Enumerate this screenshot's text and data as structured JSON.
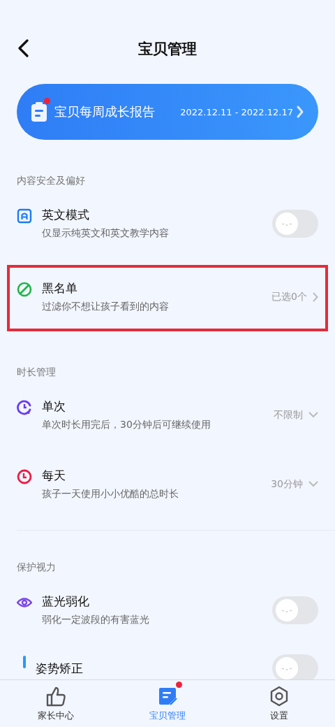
{
  "header": {
    "title": "宝贝管理"
  },
  "banner": {
    "title": "宝贝每周成长报告",
    "dates": "2022.12.11 - 2022.12.17",
    "unread": true
  },
  "sections": [
    {
      "title": "内容安全及偏好",
      "divider": false,
      "rows": [
        {
          "kind": "toggle",
          "title": "英文模式",
          "subtitle": "仅显示纯英文和英文教学内容",
          "on": false,
          "highlighted": false,
          "color": "#1e7cf0"
        },
        {
          "kind": "link",
          "title": "黑名单",
          "subtitle": "过滤你不想让孩子看到的内容",
          "value": "已选0个",
          "highlighted": true,
          "color": "#20b44a"
        }
      ]
    },
    {
      "title": "时长管理",
      "divider": true,
      "rows": [
        {
          "kind": "dropdown",
          "title": "单次",
          "subtitle": "单次时长用完后，30分钟后可继续使用",
          "value": "不限制",
          "highlighted": false,
          "color": "#6a3cf0"
        },
        {
          "kind": "dropdown",
          "title": "每天",
          "subtitle": "孩子一天使用小小优酷的总时长",
          "value": "30分钟",
          "highlighted": false,
          "color": "#ee1c48"
        }
      ]
    },
    {
      "title": "保护视力",
      "divider": false,
      "rows": [
        {
          "kind": "toggle",
          "title": "蓝光弱化",
          "subtitle": "弱化一定波段的有害蓝光",
          "on": false,
          "highlighted": false,
          "color": "#7a46e8"
        },
        {
          "kind": "toggle",
          "title": "姿势矫正",
          "on": false,
          "highlighted": false,
          "color": "#2a9af0"
        }
      ]
    }
  ],
  "tabbar": [
    {
      "label": "家长中心",
      "selected": false,
      "badge": false
    },
    {
      "label": "宝贝管理",
      "selected": true,
      "badge": true
    },
    {
      "label": "设置",
      "selected": false,
      "badge": false
    }
  ]
}
